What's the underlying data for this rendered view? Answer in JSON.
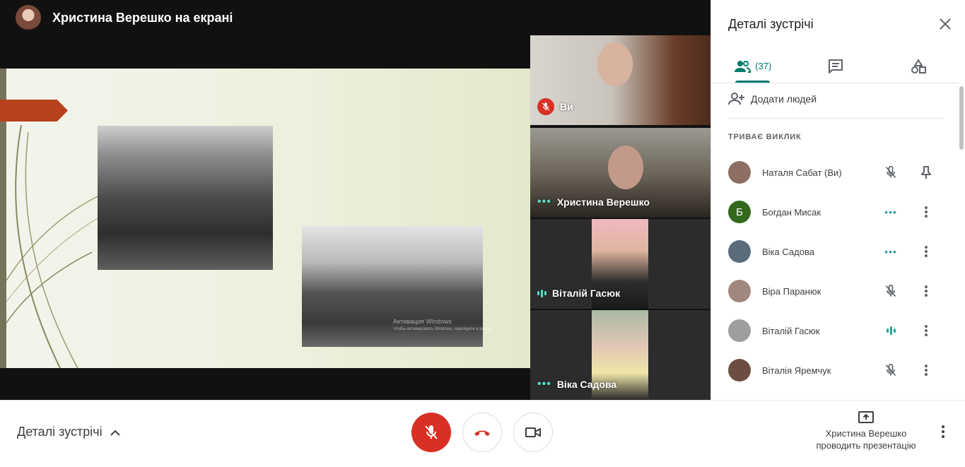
{
  "presenter": {
    "title": "Христина Верешко на екрані"
  },
  "slide": {
    "watermark_line1": "Активация Windows",
    "watermark_line2": "Чтобы активировать Windows, перейдите в раздел"
  },
  "tiles": [
    {
      "name": "Ви",
      "status": "muted"
    },
    {
      "name": "Христина Верешко",
      "status": "dots"
    },
    {
      "name": "Віталій Гасюк",
      "status": "speaking"
    },
    {
      "name": "Віка Садова",
      "status": "dots"
    }
  ],
  "panel": {
    "title": "Деталі зустрічі",
    "people_count": "(37)",
    "add_people": "Додати людей",
    "section_heading": "ТРИВАЄ ВИКЛИК",
    "participants": [
      {
        "name": "Наталя Сабат (Ви)",
        "avatar_color": "#8d6e63",
        "initial": "",
        "status": "mic-off",
        "action": "pin"
      },
      {
        "name": "Богдан Мисак",
        "avatar_color": "#33691e",
        "initial": "Б",
        "status": "dots",
        "action": "more"
      },
      {
        "name": "Віка Садова",
        "avatar_color": "#5a6b7a",
        "initial": "",
        "status": "dots",
        "action": "more"
      },
      {
        "name": "Віра Паранюк",
        "avatar_color": "#a1887f",
        "initial": "",
        "status": "mic-off",
        "action": "more"
      },
      {
        "name": "Віталій Гасюк",
        "avatar_color": "#9e9e9e",
        "initial": "",
        "status": "speaking",
        "action": "more"
      },
      {
        "name": "Віталія Яремчук",
        "avatar_color": "#6d4c41",
        "initial": "",
        "status": "mic-off",
        "action": "more"
      }
    ]
  },
  "bottom": {
    "details_label": "Деталі зустрічі",
    "present_line1": "Христина Верешко",
    "present_line2": "проводить презентацію"
  },
  "colors": {
    "accent": "#00796b",
    "danger": "#d93025",
    "speaking": "#5ad9c2"
  }
}
